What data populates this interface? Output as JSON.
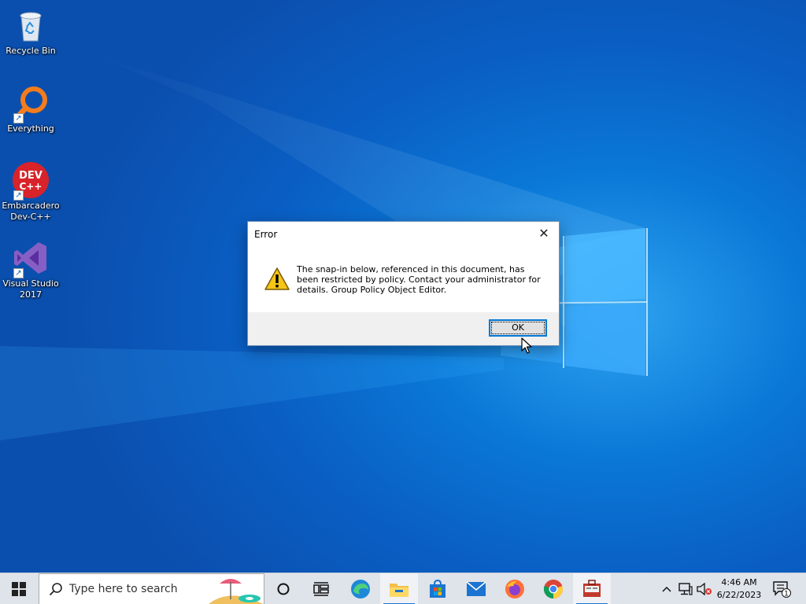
{
  "desktop": {
    "icons": [
      {
        "label": "Recycle Bin"
      },
      {
        "label": "Everything"
      },
      {
        "label": "Embarcadero Dev-C++",
        "badge": "DEV C++"
      },
      {
        "label": "Visual Studio 2017"
      }
    ]
  },
  "dialog": {
    "title": "Error",
    "close_glyph": "✕",
    "message": "The snap-in below, referenced in this document, has been restricted by policy. Contact your administrator for details. Group Policy Object Editor.",
    "ok_label": "OK",
    "icon": "warning-icon"
  },
  "taskbar": {
    "search_placeholder": "Type here to search",
    "apps": [
      "start",
      "search",
      "cortana",
      "task-view",
      "edge",
      "file-explorer",
      "microsoft-store",
      "mail",
      "firefox",
      "chrome",
      "control-panel"
    ],
    "active_app": "control-panel",
    "clock_time": "4:46 AM",
    "clock_date": "6/22/2023",
    "notification_count": "1"
  },
  "colors": {
    "accent": "#0078d7",
    "desktop_blue": "#0a78d7",
    "taskbar": "#dfe3ea"
  }
}
